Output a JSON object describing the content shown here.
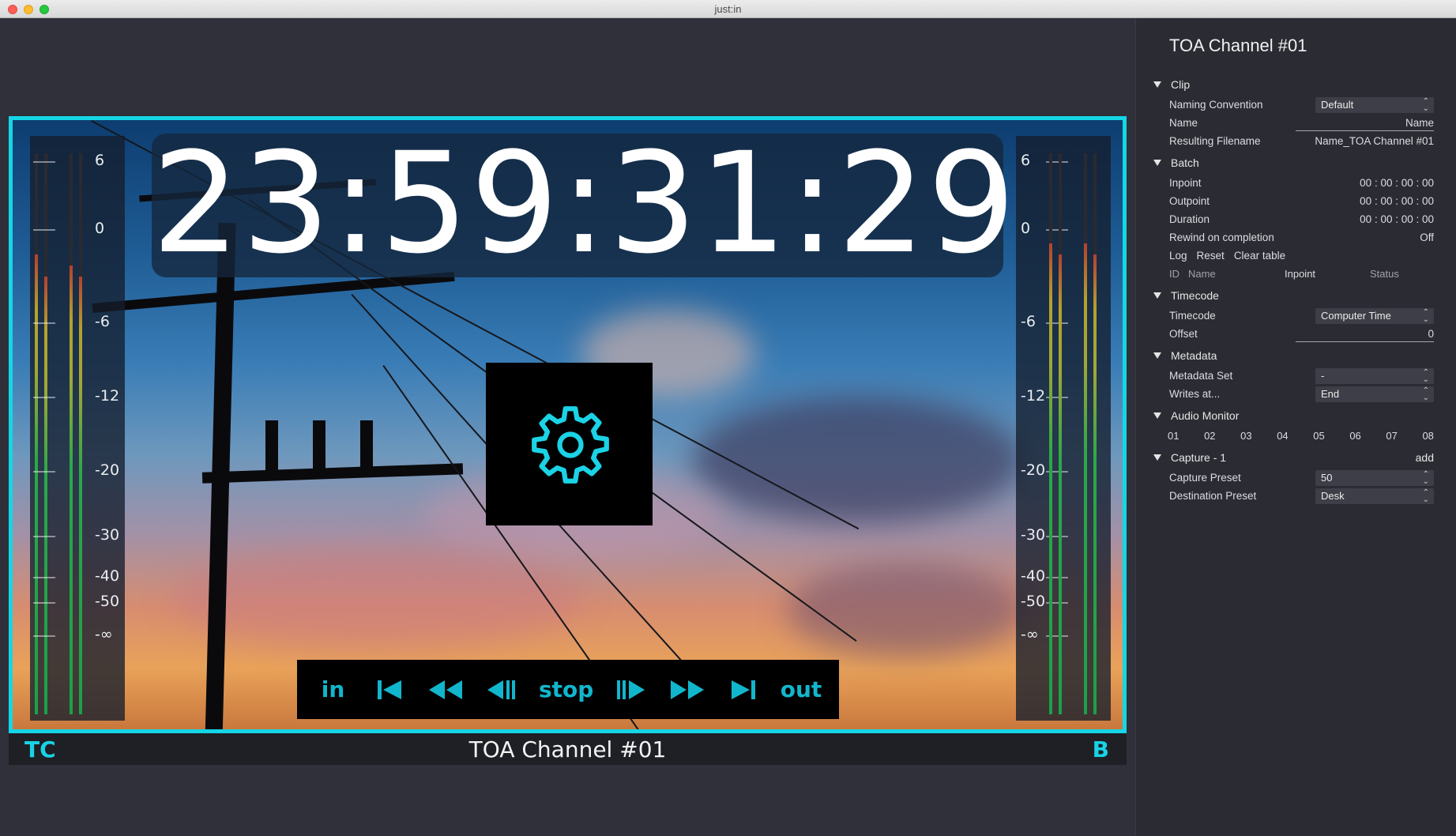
{
  "window": {
    "title": "just:in"
  },
  "preview": {
    "timecode": "23:59:31:29",
    "meter_left_labels": [
      "6",
      "0",
      "-6",
      "-12",
      "-20",
      "-30",
      "-40",
      "-50",
      "-∞"
    ],
    "meter_right_labels": [
      "6",
      "0",
      "-6",
      "-12",
      "-20",
      "-30",
      "-40",
      "-50",
      "-∞"
    ],
    "meter_levels_left": [
      0.82,
      0.78,
      0.8,
      0.78
    ],
    "meter_levels_right": [
      0.84,
      0.82,
      0.84,
      0.82
    ],
    "transport": {
      "in_label": "in",
      "stop_label": "stop",
      "out_label": "out"
    },
    "icons": [
      "gear-icon",
      "skip-to-start-icon",
      "rewind-icon",
      "step-back-icon",
      "step-forward-icon",
      "fast-forward-icon",
      "skip-to-end-icon"
    ],
    "accent_color": "#14d6e6"
  },
  "bottom_bar": {
    "left": "TC",
    "center": "TOA Channel #01",
    "right": "B"
  },
  "sidebar": {
    "title": "TOA Channel #01",
    "clip": {
      "header": "Clip",
      "naming_convention_label": "Naming Convention",
      "naming_convention_value": "Default",
      "name_label": "Name",
      "name_value": "Name",
      "resulting_filename_label": "Resulting Filename",
      "resulting_filename_value": "Name_TOA Channel #01"
    },
    "batch": {
      "header": "Batch",
      "inpoint_label": "Inpoint",
      "inpoint_value": "00 : 00 : 00 : 00",
      "outpoint_label": "Outpoint",
      "outpoint_value": "00 : 00 : 00 : 00",
      "duration_label": "Duration",
      "duration_value": "00 : 00 : 00 : 00",
      "rewind_label": "Rewind on completion",
      "rewind_value": "Off",
      "log_label": "Log",
      "reset_label": "Reset",
      "clear_label": "Clear table",
      "col_id": "ID",
      "col_name": "Name",
      "col_inpoint": "Inpoint",
      "col_status": "Status"
    },
    "timecode": {
      "header": "Timecode",
      "timecode_label": "Timecode",
      "timecode_value": "Computer Time",
      "offset_label": "Offset",
      "offset_value": "0"
    },
    "metadata": {
      "header": "Metadata",
      "set_label": "Metadata Set",
      "set_value": "-",
      "writes_label": "Writes at...",
      "writes_value": "End"
    },
    "audio_monitor": {
      "header": "Audio Monitor",
      "channels": [
        "01",
        "02",
        "03",
        "04",
        "05",
        "06",
        "07",
        "08"
      ]
    },
    "capture": {
      "header": "Capture - 1",
      "add_label": "add",
      "preset_label": "Capture Preset",
      "preset_value": "50",
      "destination_label": "Destination Preset",
      "destination_value": "Desk"
    }
  }
}
